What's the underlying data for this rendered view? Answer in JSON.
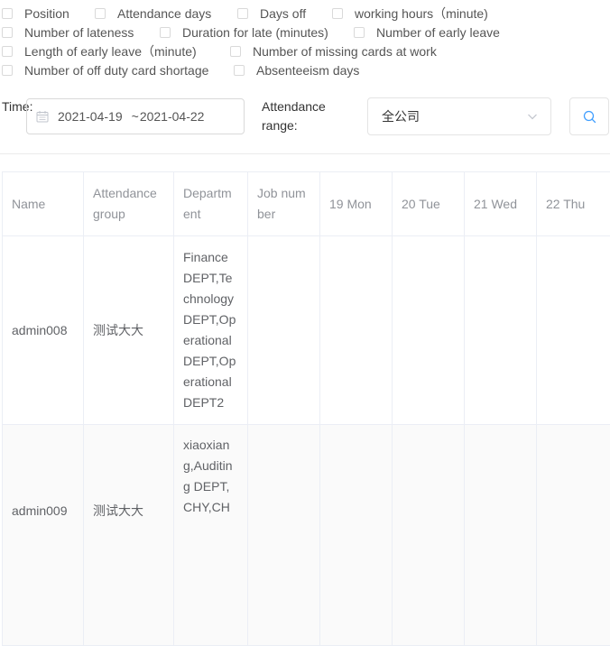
{
  "checkboxes": [
    [
      {
        "label": "Position"
      },
      {
        "label": "Attendance days"
      },
      {
        "label": "Days off"
      },
      {
        "label": "working hours（minute)"
      }
    ],
    [
      {
        "label": "Number of lateness"
      },
      {
        "label": "Duration for late (minutes)"
      },
      {
        "label": "Number of early leave"
      }
    ],
    [
      {
        "label": "Length of early leave（minute)"
      },
      {
        "label": "Number of missing cards at work"
      }
    ],
    [
      {
        "label": "Number of off duty card shortage"
      },
      {
        "label": "Absenteeism days"
      }
    ]
  ],
  "filter": {
    "time_label": "Time:",
    "date_start": "2021-04-19",
    "date_separator": "~",
    "date_end": "2021-04-22",
    "range_label": "Attendance range:",
    "range_value": "全公司"
  },
  "table": {
    "headers": [
      "Name",
      "Attendance group",
      "Department",
      "Job number",
      "19 Mon",
      "20 Tue",
      "21 Wed",
      "22 Thu"
    ],
    "rows": [
      {
        "name": "admin008",
        "group": "测试大大",
        "department": "Finance DEPT,Technology DEPT,Operational DEPT,Operational DEPT2",
        "job_number": "",
        "days": [
          "",
          "",
          "",
          ""
        ]
      },
      {
        "name": "admin009",
        "group": "测试大大",
        "department": "xiaoxiang,Auditing DEPT,CHY,CH",
        "job_number": "",
        "days": [
          "",
          "",
          "",
          ""
        ]
      }
    ]
  }
}
